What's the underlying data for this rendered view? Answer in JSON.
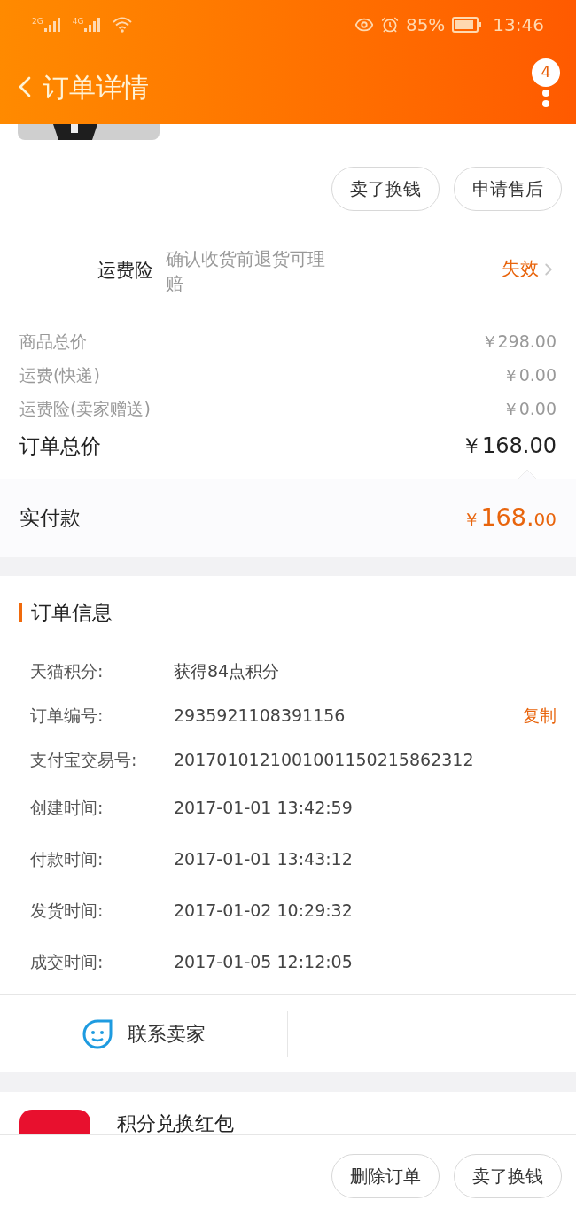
{
  "status_bar": {
    "network_1": "2G",
    "network_2": "4G",
    "battery": "85%",
    "time": "13:46"
  },
  "header": {
    "title": "订单详情",
    "badge": "4"
  },
  "item_actions": [
    "卖了换钱",
    "申请售后"
  ],
  "insurance": {
    "label": "运费险",
    "description": "确认收货前退货可理赔",
    "status": "失效"
  },
  "price_rows": [
    {
      "label": "商品总价",
      "value": "￥298.00"
    },
    {
      "label": "运费(快递)",
      "value": "￥0.00"
    },
    {
      "label": "运费险(卖家赠送)",
      "value": "￥0.00"
    }
  ],
  "order_total": {
    "label": "订单总价",
    "value": "￥168.00"
  },
  "paid": {
    "label": "实付款",
    "currency": "￥",
    "integer": "168.",
    "decimals": "00"
  },
  "order_info": {
    "title": "订单信息",
    "rows": [
      {
        "label": "天猫积分:",
        "value": "获得84点积分"
      },
      {
        "label": "订单编号:",
        "value": "2935921108391156",
        "action": "复制"
      },
      {
        "label": "支付宝交易号:",
        "value": "2017010121001001150215862312"
      },
      {
        "label": "创建时间:",
        "value": "2017-01-01 13:42:59"
      },
      {
        "label": "付款时间:",
        "value": "2017-01-01 13:43:12"
      },
      {
        "label": "发货时间:",
        "value": "2017-01-02 10:29:32"
      },
      {
        "label": "成交时间:",
        "value": "2017-01-05 12:12:05"
      }
    ]
  },
  "contact": {
    "label": "联系卖家"
  },
  "promo": {
    "title": "积分兑换红包"
  },
  "bottom_actions": [
    "删除订单",
    "卖了换钱"
  ]
}
